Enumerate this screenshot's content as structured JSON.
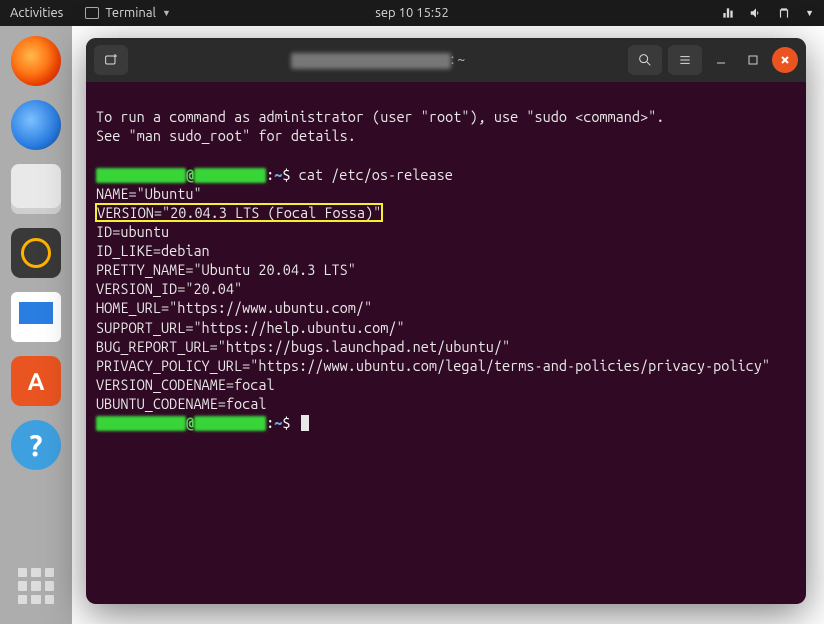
{
  "topbar": {
    "activities": "Activities",
    "app_name": "Terminal",
    "clock": "sep 10  15:52"
  },
  "dock": {
    "items": [
      "firefox",
      "thunderbird",
      "files",
      "rhythmbox",
      "libreoffice-writer",
      "ubuntu-software",
      "help"
    ]
  },
  "window": {
    "title_suffix": ": ~"
  },
  "terminal": {
    "sudo_notice_1": "To run a command as administrator (user \"root\"), use \"sudo <command>\".",
    "sudo_notice_2": "See \"man sudo_root\" for details.",
    "prompt_path": "~",
    "prompt_symbol": "$",
    "command": "cat /etc/os-release",
    "output": {
      "l1": "NAME=\"Ubuntu\"",
      "l2": "VERSION=\"20.04.3 LTS (Focal Fossa)\"",
      "l3": "ID=ubuntu",
      "l4": "ID_LIKE=debian",
      "l5": "PRETTY_NAME=\"Ubuntu 20.04.3 LTS\"",
      "l6": "VERSION_ID=\"20.04\"",
      "l7": "HOME_URL=\"https://www.ubuntu.com/\"",
      "l8": "SUPPORT_URL=\"https://help.ubuntu.com/\"",
      "l9": "BUG_REPORT_URL=\"https://bugs.launchpad.net/ubuntu/\"",
      "l10": "PRIVACY_POLICY_URL=\"https://www.ubuntu.com/legal/terms-and-policies/privacy-policy\"",
      "l11": "VERSION_CODENAME=focal",
      "l12": "UBUNTU_CODENAME=focal"
    }
  }
}
